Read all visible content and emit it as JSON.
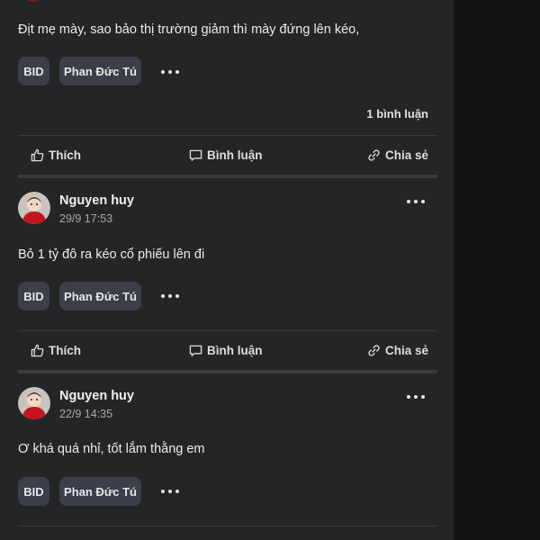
{
  "posts": [
    {
      "content": "Địt mẹ mày, sao bảo thị trường giảm thì mày đứng lên kéo,",
      "tags": [
        "BID",
        "Phan Đức Tú"
      ],
      "comment_count": "1 bình luận"
    },
    {
      "author": "Nguyen huy",
      "date": "29/9 17:53",
      "content": "Bỏ 1 tỷ đô ra kéo cổ phiếu lên đi",
      "tags": [
        "BID",
        "Phan Đức Tú"
      ]
    },
    {
      "author": "Nguyen huy",
      "date": "22/9 14:35",
      "content": "Ơ khá quá nhỉ, tốt lắm thằng em",
      "tags": [
        "BID",
        "Phan Đức Tú"
      ]
    }
  ],
  "actions": {
    "like": "Thích",
    "comment": "Bình luận",
    "share": "Chia sẻ"
  },
  "icons": {
    "like": "thumbs-up-icon",
    "comment": "comment-icon",
    "share": "link-icon",
    "more": "more-horizontal-icon"
  }
}
